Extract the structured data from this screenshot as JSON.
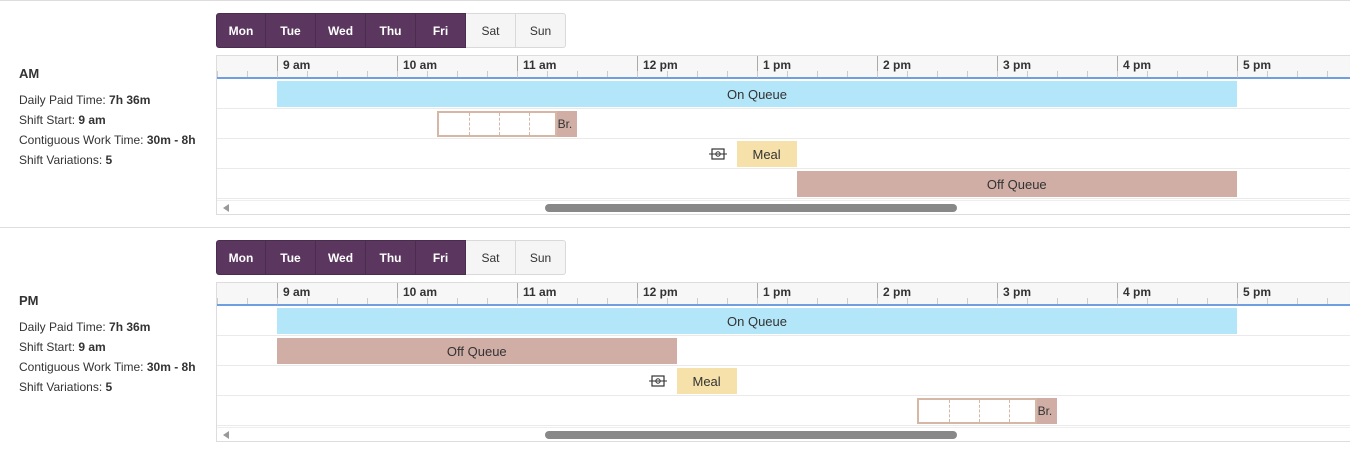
{
  "hours": [
    "9 am",
    "10 am",
    "11 am",
    "12 pm",
    "1 pm",
    "2 pm",
    "3 pm",
    "4 pm",
    "5 pm"
  ],
  "shifts": [
    {
      "name": "AM",
      "days": [
        {
          "label": "Mon",
          "active": true
        },
        {
          "label": "Tue",
          "active": true
        },
        {
          "label": "Wed",
          "active": true
        },
        {
          "label": "Thu",
          "active": true
        },
        {
          "label": "Fri",
          "active": true
        },
        {
          "label": "Sat",
          "active": false
        },
        {
          "label": "Sun",
          "active": false
        }
      ],
      "daily_paid_label": "Daily Paid Time:",
      "daily_paid_value": "7h 36m",
      "shift_start_label": "Shift Start:",
      "shift_start_value": "9 am",
      "contig_label": "Contiguous Work Time:",
      "contig_value": "30m - 8h",
      "variations_label": "Shift Variations:",
      "variations_value": "5",
      "activities": {
        "on_queue": {
          "label": "On Queue",
          "start_hour": 9.0,
          "end_hour": 17.0
        },
        "break": {
          "label": "Br.",
          "window_start_hour": 10.33,
          "window_end_hour": 11.33,
          "end_hour": 11.5
        },
        "meal": {
          "label": "Meal",
          "start_hour": 12.83,
          "end_hour": 13.33
        },
        "off_queue": {
          "label": "Off Queue",
          "start_hour": 13.33,
          "end_hour": 17.0
        }
      }
    },
    {
      "name": "PM",
      "days": [
        {
          "label": "Mon",
          "active": true
        },
        {
          "label": "Tue",
          "active": true
        },
        {
          "label": "Wed",
          "active": true
        },
        {
          "label": "Thu",
          "active": true
        },
        {
          "label": "Fri",
          "active": true
        },
        {
          "label": "Sat",
          "active": false
        },
        {
          "label": "Sun",
          "active": false
        }
      ],
      "daily_paid_label": "Daily Paid Time:",
      "daily_paid_value": "7h 36m",
      "shift_start_label": "Shift Start:",
      "shift_start_value": "9 am",
      "contig_label": "Contiguous Work Time:",
      "contig_value": "30m - 8h",
      "variations_label": "Shift Variations:",
      "variations_value": "5",
      "activities": {
        "on_queue": {
          "label": "On Queue",
          "start_hour": 9.0,
          "end_hour": 17.0
        },
        "off_queue": {
          "label": "Off Queue",
          "start_hour": 9.0,
          "end_hour": 12.33
        },
        "meal": {
          "label": "Meal",
          "start_hour": 12.33,
          "end_hour": 12.83
        },
        "break": {
          "label": "Br.",
          "window_start_hour": 14.33,
          "window_end_hour": 15.33,
          "end_hour": 15.5
        }
      }
    }
  ],
  "colors": {
    "active_day": "#5b3760",
    "on_queue": "#b3e6f8",
    "off_queue": "#d0aea6",
    "meal": "#f6e1aa"
  }
}
